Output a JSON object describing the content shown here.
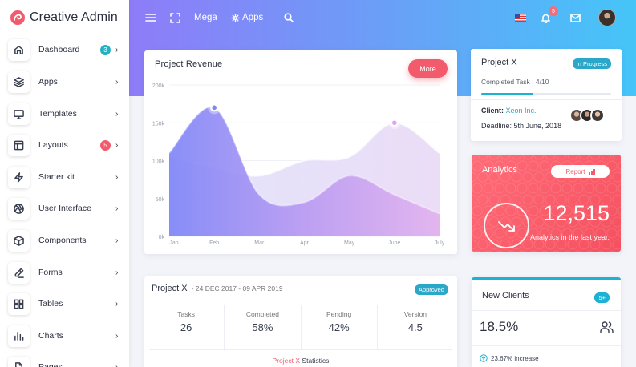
{
  "brand": {
    "name": "Creative Admin"
  },
  "sidebar": {
    "items": [
      {
        "label": "Dashboard",
        "icon": "home-icon",
        "badge": "3",
        "badge_color": "#24b1c4"
      },
      {
        "label": "Apps",
        "icon": "layers-icon",
        "badge": "",
        "badge_color": ""
      },
      {
        "label": "Templates",
        "icon": "monitor-icon",
        "badge": "",
        "badge_color": ""
      },
      {
        "label": "Layouts",
        "icon": "layout-icon",
        "badge": "5",
        "badge_color": "#f15b6c"
      },
      {
        "label": "Starter kit",
        "icon": "zap-icon",
        "badge": "",
        "badge_color": ""
      },
      {
        "label": "User Interface",
        "icon": "aperture-icon",
        "badge": "",
        "badge_color": ""
      },
      {
        "label": "Components",
        "icon": "box-icon",
        "badge": "",
        "badge_color": ""
      },
      {
        "label": "Forms",
        "icon": "edit-icon",
        "badge": "",
        "badge_color": ""
      },
      {
        "label": "Tables",
        "icon": "grid-icon",
        "badge": "",
        "badge_color": ""
      },
      {
        "label": "Charts",
        "icon": "bar-chart-icon",
        "badge": "",
        "badge_color": ""
      },
      {
        "label": "Pages",
        "icon": "file-icon",
        "badge": "",
        "badge_color": ""
      }
    ]
  },
  "topbar": {
    "mega_label": "Mega",
    "apps_label": "Apps",
    "notification_count": "5"
  },
  "revenue": {
    "title": "Project Revenue",
    "more_label": "More"
  },
  "chart_data": {
    "type": "area",
    "title": "Project Revenue",
    "categories": [
      "Jan",
      "Feb",
      "Mar",
      "Apr",
      "May",
      "June",
      "July"
    ],
    "y_ticks": [
      "0k",
      "50k",
      "100k",
      "150k",
      "200k"
    ],
    "ylim": [
      0,
      200
    ],
    "series": [
      {
        "values": [
          110,
          170,
          55,
          45,
          80,
          55,
          30
        ]
      },
      {
        "values": [
          105,
          90,
          80,
          100,
          105,
          150,
          110
        ]
      }
    ]
  },
  "project_x": {
    "title": "Project X",
    "status": "In Progress",
    "completed_task": "Completed Task : 4/10",
    "progress": 0.4,
    "client_label": "Client:",
    "client_name": "Xeon Inc.",
    "deadline": "Deadline: 5th June, 2018"
  },
  "analytics": {
    "title": "Analytics",
    "report_label": "Report",
    "value": "12,515",
    "subtitle": "Analytics in the last year."
  },
  "stats": {
    "title": "Project X",
    "date_range": "- 24 DEC 2017 - 09 APR 2019",
    "badge": "Approved",
    "columns": [
      {
        "label": "Tasks",
        "value": "26"
      },
      {
        "label": "Completed",
        "value": "58%"
      },
      {
        "label": "Pending",
        "value": "42%"
      },
      {
        "label": "Version",
        "value": "4.5"
      }
    ],
    "footer_project": "Project X",
    "footer_rest": "Statistics"
  },
  "new_clients": {
    "title": "New Clients",
    "badge": "5+",
    "percent": "18.5%",
    "increase": "23.67% increase"
  },
  "colors": {
    "accent_red": "#f15b6c",
    "accent_teal": "#1cb2d4",
    "header_gradient_start": "#8e7cf8",
    "header_gradient_end": "#45c5f8"
  }
}
